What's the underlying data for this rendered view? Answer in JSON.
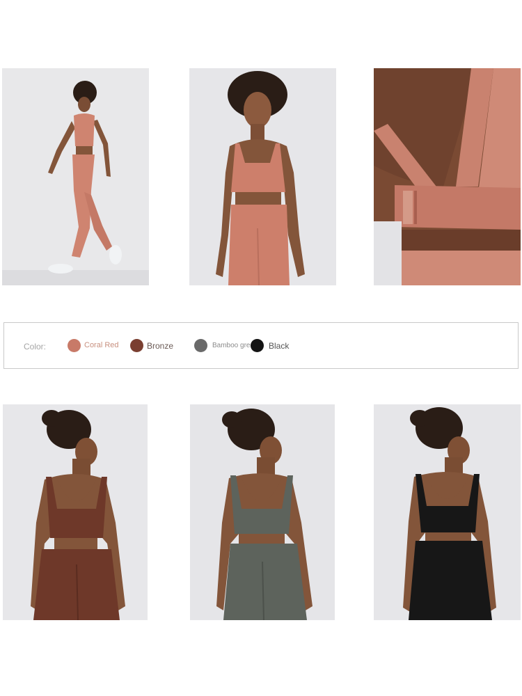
{
  "color_selector": {
    "label": "Color:",
    "options": [
      {
        "name": "Coral Red",
        "hex": "#c87a68",
        "text_color": "#c8907f"
      },
      {
        "name": "Bronze",
        "hex": "#7a3f31",
        "text_color": "#6a5a55"
      },
      {
        "name": "Bamboo green",
        "hex": "#6a6a6a",
        "text_color": "#8b8b8b"
      },
      {
        "name": "Black",
        "hex": "#141414",
        "text_color": "#555555"
      }
    ]
  },
  "photos": [
    {
      "name": "coral-red-walking",
      "outfit_color": "#cf8470"
    },
    {
      "name": "coral-red-front",
      "outfit_color": "#cd7f6b"
    },
    {
      "name": "coral-red-back-closeup",
      "outfit_color": "#c9826f"
    },
    {
      "name": "bronze-back",
      "outfit_color": "#6e3829"
    },
    {
      "name": "bamboo-green-back",
      "outfit_color": "#5d635c"
    },
    {
      "name": "black-back",
      "outfit_color": "#171717"
    }
  ]
}
